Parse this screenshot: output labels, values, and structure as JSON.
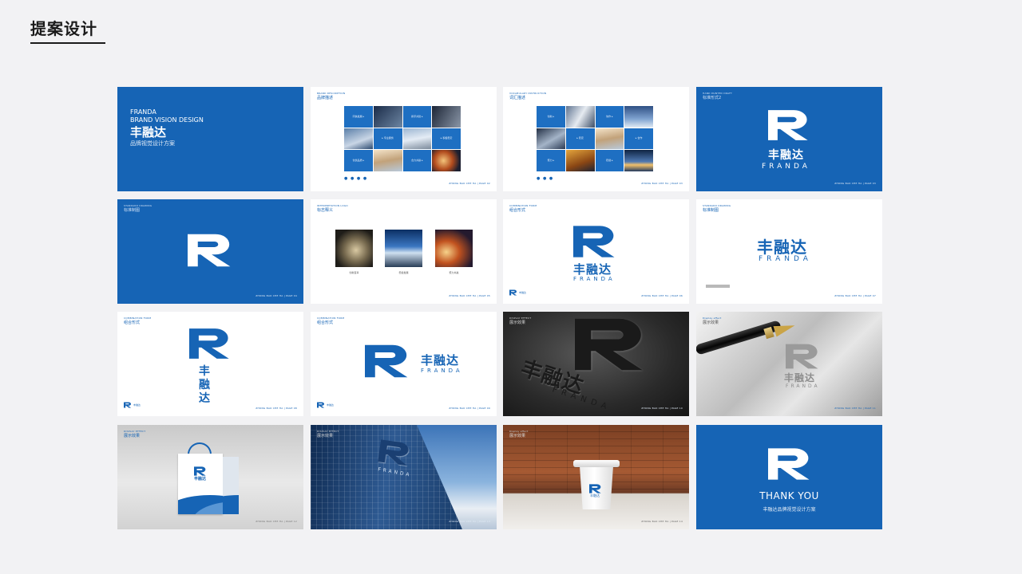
{
  "page": {
    "title": "提案设计"
  },
  "brand": {
    "name_cn": "丰融达",
    "name_en": "FRANDA",
    "accent": "#1664b5"
  },
  "slides": {
    "s1": {
      "l1": "FRANDA",
      "l2": "BRAND VISION DESIGN",
      "l3": "丰融达",
      "l4": "品牌视觉设计方案"
    },
    "s2": {
      "en": "BRAND DESCRIPTION",
      "cn": "品牌描述",
      "tiles": [
        "同信发展 ▸",
        "携手共建 ▸",
        "▸ 专业服务",
        "▸ 积极稳定",
        "创优品质 ▸",
        "合力共赢 ▸"
      ],
      "footer": "ZHONG BAO CHE HA | PAGE 02"
    },
    "s3": {
      "en": "VOCABULARY INSTRUCTION",
      "cn": "词汇描述",
      "tiles": [
        "创新 ▸",
        "协作 ▸",
        "▸ 稳定",
        "▸ 合作",
        "聚力 ▸",
        "稳健 ▸"
      ],
      "footer": "ZHONG BAO CHE HA | PAGE 03"
    },
    "s4": {
      "en": "HAND PAINTED DRAFT",
      "cn": "标准形式2",
      "name": "丰融达",
      "en_name": "FRANDA",
      "footer": "ZHONG BAO CHE HA | PAGE 03"
    },
    "s5": {
      "en": "STANDARD DRAWING",
      "cn": "标准制图",
      "footer": "ZHONG BAO CHE HA | PAGE 04"
    },
    "s6": {
      "en": "INTERPRETATION LOGO",
      "cn": "标志释义",
      "caps": [
        "创新变革",
        "稳健发展",
        "聚力共赢"
      ],
      "footer": "ZHONG BAO CHE HA | PAGE 05"
    },
    "s7": {
      "en": "COMBINATION FORM",
      "cn": "组合形式",
      "name": "丰融达",
      "en_name": "FRANDA",
      "mini": "丰融达",
      "footer": "ZHONG BAO CHE HA | PAGE 06"
    },
    "s8": {
      "en": "STANDARD DRAWING",
      "cn": "标准制图",
      "name": "丰融达",
      "en_name": "FRANDA",
      "footer": "ZHONG BAO CHE HA | PAGE 07"
    },
    "s9": {
      "en": "COMBINATION FORM",
      "cn": "组合形式",
      "c1": "丰",
      "c2": "融",
      "c3": "达",
      "mini": "丰融达",
      "footer": "ZHONG BAO CHE HA | PAGE 08"
    },
    "s10": {
      "en": "COMBINATION FORM",
      "cn": "组合形式",
      "name": "丰融达",
      "en_name": "FRANDA",
      "mini": "丰融达",
      "footer": "ZHONG BAO CHE HA | PAGE 09"
    },
    "s11": {
      "en": "DISPLAY EFFECT",
      "cn": "展示效果",
      "name": "丰融达",
      "en_name": "FRANDA",
      "footer": "ZHONG BAO CHE HA | PAGE 10"
    },
    "s12": {
      "en": "Display effect",
      "cn": "展示效果",
      "name": "丰融达",
      "en_name": "FRANDA",
      "footer": "ZHONG BAO CHE HA | PAGE 11"
    },
    "s13": {
      "en": "DISPLAY EFFECT",
      "cn": "展示效果",
      "bag": "丰融达",
      "footer": "ZHONG BAO CHE HA | PAGE 12"
    },
    "s14": {
      "en": "DISPLAY EFFECT",
      "cn": "展示效果",
      "en_name": "FRANDA",
      "footer": "ZHONG BAO CHE HA | PAGE 13"
    },
    "s15": {
      "en": "Display effect",
      "cn": "展示效果",
      "cup": "丰融达",
      "footer": "ZHONG BAO CHE HA | PAGE 14"
    },
    "s16": {
      "thanks": "THANK YOU",
      "sub": "丰融达品牌视觉设计方案"
    }
  }
}
